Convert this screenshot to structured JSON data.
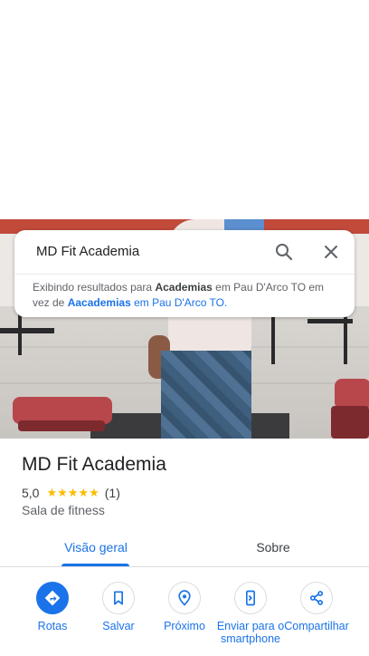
{
  "search": {
    "query": "MD Fit Academia",
    "suggestion_prefix": "Exibindo resultados para",
    "suggestion_term": "Academias",
    "suggestion_location": "em Pau D'Arco TO em",
    "suggestion_middle": "vez de",
    "original_term": "Aacademias",
    "original_location": "em Pau D'Arco TO."
  },
  "place": {
    "name": "MD Fit Academia",
    "rating": "5,0",
    "stars": "★★★★★",
    "review_count": "(1)",
    "category": "Sala de fitness"
  },
  "tabs": [
    {
      "label": "Visão geral"
    },
    {
      "label": "Sobre"
    }
  ],
  "actions": [
    {
      "label": "Rotas",
      "icon": "directions-icon"
    },
    {
      "label": "Salvar",
      "icon": "bookmark-icon"
    },
    {
      "label": "Próximo",
      "icon": "nearby-icon"
    },
    {
      "label": "Enviar para o smartphone",
      "icon": "send-to-phone-icon"
    },
    {
      "label": "Compartilhar",
      "icon": "share-icon"
    }
  ],
  "colors": {
    "accent": "#1a73e8",
    "star": "#fbbc04"
  }
}
